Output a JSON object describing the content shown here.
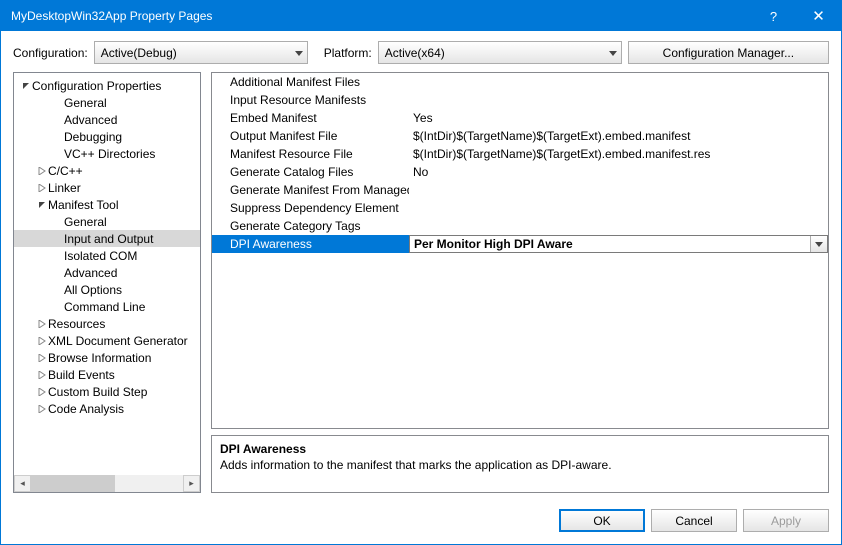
{
  "window_title": "MyDesktopWin32App Property Pages",
  "toolbar": {
    "configuration_label": "Configuration:",
    "configuration_value": "Active(Debug)",
    "platform_label": "Platform:",
    "platform_value": "Active(x64)",
    "config_manager_label": "Configuration Manager..."
  },
  "tree": [
    {
      "label": "Configuration Properties",
      "indent": 0,
      "expander": "open"
    },
    {
      "label": "General",
      "indent": 2,
      "expander": "none"
    },
    {
      "label": "Advanced",
      "indent": 2,
      "expander": "none"
    },
    {
      "label": "Debugging",
      "indent": 2,
      "expander": "none"
    },
    {
      "label": "VC++ Directories",
      "indent": 2,
      "expander": "none"
    },
    {
      "label": "C/C++",
      "indent": 1,
      "expander": "closed"
    },
    {
      "label": "Linker",
      "indent": 1,
      "expander": "closed"
    },
    {
      "label": "Manifest Tool",
      "indent": 1,
      "expander": "open"
    },
    {
      "label": "General",
      "indent": 2,
      "expander": "none"
    },
    {
      "label": "Input and Output",
      "indent": 2,
      "expander": "none",
      "selected": true
    },
    {
      "label": "Isolated COM",
      "indent": 2,
      "expander": "none"
    },
    {
      "label": "Advanced",
      "indent": 2,
      "expander": "none"
    },
    {
      "label": "All Options",
      "indent": 2,
      "expander": "none"
    },
    {
      "label": "Command Line",
      "indent": 2,
      "expander": "none"
    },
    {
      "label": "Resources",
      "indent": 1,
      "expander": "closed"
    },
    {
      "label": "XML Document Generator",
      "indent": 1,
      "expander": "closed"
    },
    {
      "label": "Browse Information",
      "indent": 1,
      "expander": "closed"
    },
    {
      "label": "Build Events",
      "indent": 1,
      "expander": "closed"
    },
    {
      "label": "Custom Build Step",
      "indent": 1,
      "expander": "closed"
    },
    {
      "label": "Code Analysis",
      "indent": 1,
      "expander": "closed"
    }
  ],
  "properties": [
    {
      "key": "Additional Manifest Files",
      "value": ""
    },
    {
      "key": "Input Resource Manifests",
      "value": ""
    },
    {
      "key": "Embed Manifest",
      "value": "Yes"
    },
    {
      "key": "Output Manifest File",
      "value": "$(IntDir)$(TargetName)$(TargetExt).embed.manifest"
    },
    {
      "key": "Manifest Resource File",
      "value": "$(IntDir)$(TargetName)$(TargetExt).embed.manifest.res"
    },
    {
      "key": "Generate Catalog Files",
      "value": "No"
    },
    {
      "key": "Generate Manifest From ManagedAssembly",
      "value": ""
    },
    {
      "key": "Suppress Dependency Element",
      "value": ""
    },
    {
      "key": "Generate Category Tags",
      "value": ""
    },
    {
      "key": "DPI Awareness",
      "value": "Per Monitor High DPI Aware",
      "selected": true
    }
  ],
  "description": {
    "title": "DPI Awareness",
    "text": "Adds information to the manifest that marks the application as DPI-aware."
  },
  "buttons": {
    "ok": "OK",
    "cancel": "Cancel",
    "apply": "Apply"
  }
}
